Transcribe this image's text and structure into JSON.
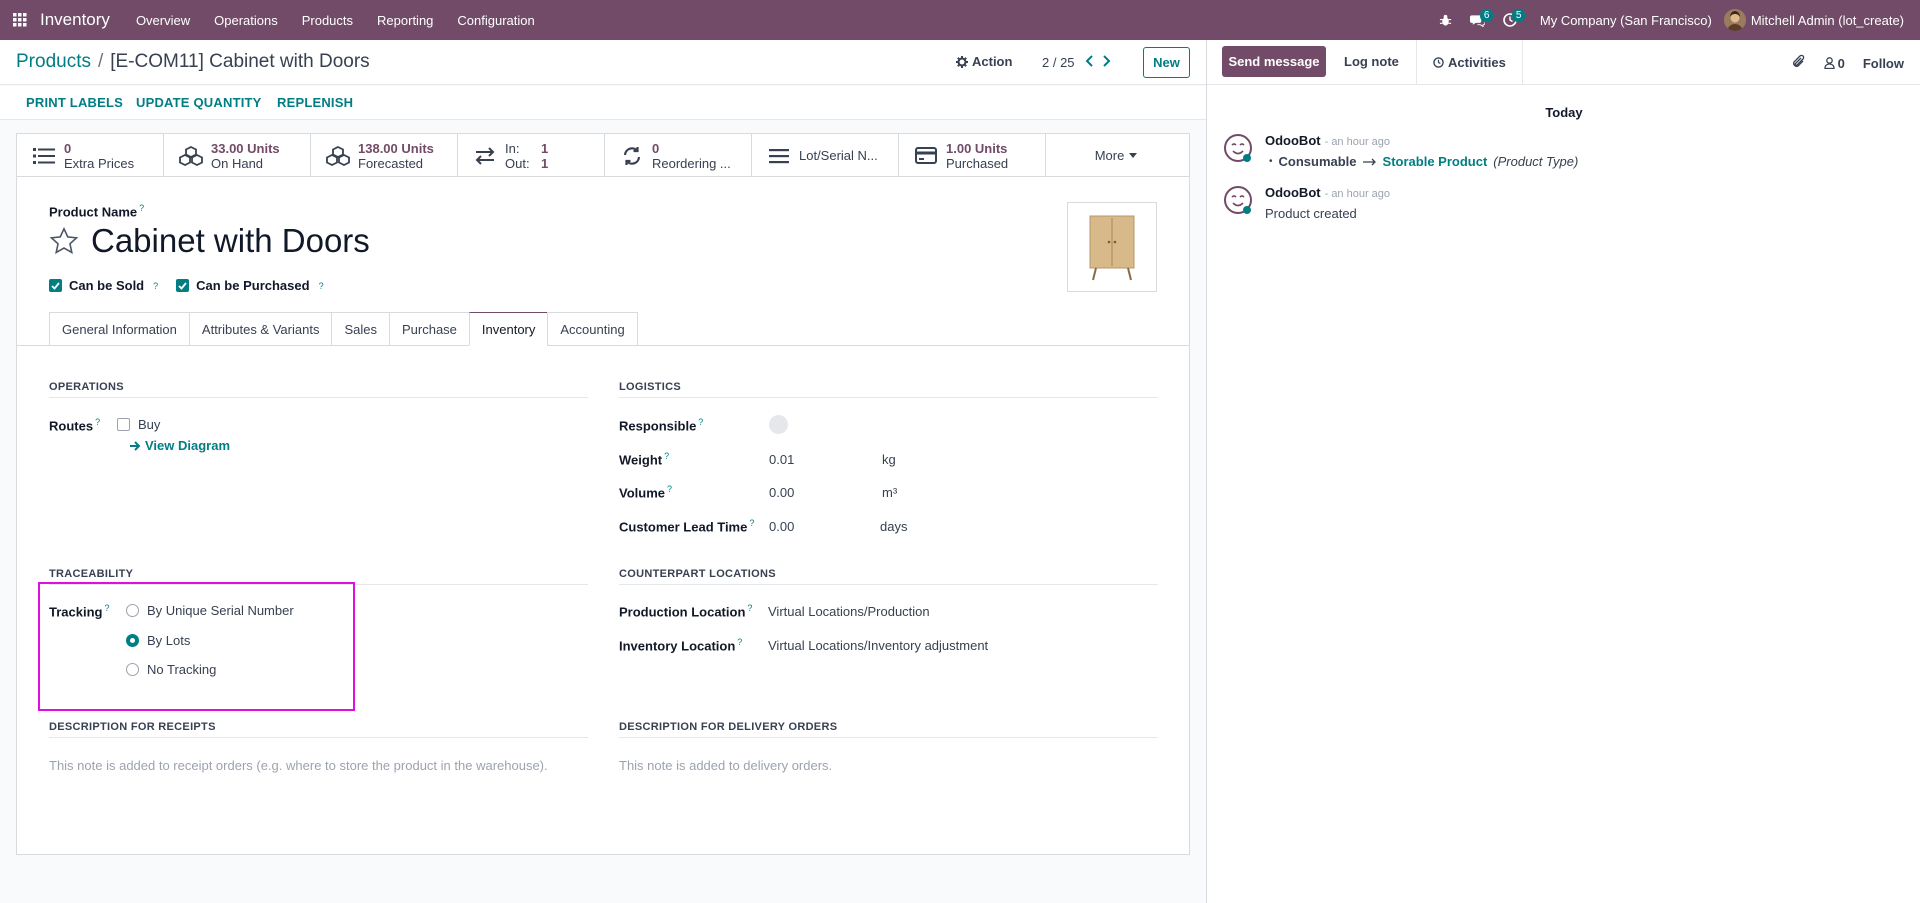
{
  "navbar": {
    "app_name": "Inventory",
    "menu": [
      "Overview",
      "Operations",
      "Products",
      "Reporting",
      "Configuration"
    ],
    "messages_badge": "6",
    "activities_badge": "5",
    "company": "My Company (San Francisco)",
    "user": "Mitchell Admin (lot_create)"
  },
  "control": {
    "breadcrumb_parent": "Products",
    "breadcrumb_sep": "/",
    "breadcrumb_current": "[E-COM11] Cabinet with Doors",
    "action_label": "Action",
    "pager": "2 / 25",
    "new_label": "New"
  },
  "statusbar": {
    "buttons": [
      "PRINT LABELS",
      "UPDATE QUANTITY",
      "REPLENISH"
    ]
  },
  "smart_buttons": {
    "extra_prices": {
      "value": "0",
      "label": "Extra Prices"
    },
    "on_hand": {
      "value": "33.00 Units",
      "label": "On Hand"
    },
    "forecasted": {
      "value": "138.00 Units",
      "label": "Forecasted"
    },
    "in_out": {
      "in_label": "In:",
      "in_value": "1",
      "out_label": "Out:",
      "out_value": "1"
    },
    "reordering": {
      "value": "0",
      "label": "Reordering ..."
    },
    "lot_serial": {
      "label": "Lot/Serial N..."
    },
    "purchased": {
      "value": "1.00 Units",
      "label": "Purchased"
    },
    "more": "More"
  },
  "product": {
    "name_label": "Product Name",
    "help_mark": "?",
    "name": "Cabinet with Doors",
    "can_be_sold": "Can be Sold",
    "can_be_purchased": "Can be Purchased"
  },
  "tabs": [
    "General Information",
    "Attributes & Variants",
    "Sales",
    "Purchase",
    "Inventory",
    "Accounting"
  ],
  "operations": {
    "title": "OPERATIONS",
    "routes_label": "Routes",
    "route_buy": "Buy",
    "view_diagram": "View Diagram"
  },
  "logistics": {
    "title": "LOGISTICS",
    "responsible_label": "Responsible",
    "weight_label": "Weight",
    "weight_value": "0.01",
    "weight_unit": "kg",
    "volume_label": "Volume",
    "volume_value": "0.00",
    "volume_unit": "m³",
    "lead_time_label": "Customer Lead Time",
    "lead_time_value": "0.00",
    "lead_time_unit": "days"
  },
  "traceability": {
    "title": "TRACEABILITY",
    "tracking_label": "Tracking",
    "options": [
      "By Unique Serial Number",
      "By Lots",
      "No Tracking"
    ],
    "selected": "By Lots"
  },
  "counterpart": {
    "title": "COUNTERPART LOCATIONS",
    "production_label": "Production Location",
    "production_value": "Virtual Locations/Production",
    "inventory_label": "Inventory Location",
    "inventory_value": "Virtual Locations/Inventory adjustment"
  },
  "descriptions": {
    "receipts_title": "DESCRIPTION FOR RECEIPTS",
    "receipts_placeholder": "This note is added to receipt orders (e.g. where to store the product in the warehouse).",
    "delivery_title": "DESCRIPTION FOR DELIVERY ORDERS",
    "delivery_placeholder": "This note is added to delivery orders."
  },
  "chatter": {
    "send_message": "Send message",
    "log_note": "Log note",
    "activities": "Activities",
    "followers_count": "0",
    "follow": "Follow",
    "today": "Today",
    "messages": [
      {
        "author": "OdooBot",
        "time": "- an hour ago",
        "old": "Consumable",
        "new": "Storable Product",
        "field": "(Product Type)"
      },
      {
        "author": "OdooBot",
        "time": "- an hour ago",
        "body": "Product created"
      }
    ]
  },
  "colors": {
    "brand": "#714b67",
    "accent": "#017e84",
    "highlight": "#e10ee1"
  }
}
